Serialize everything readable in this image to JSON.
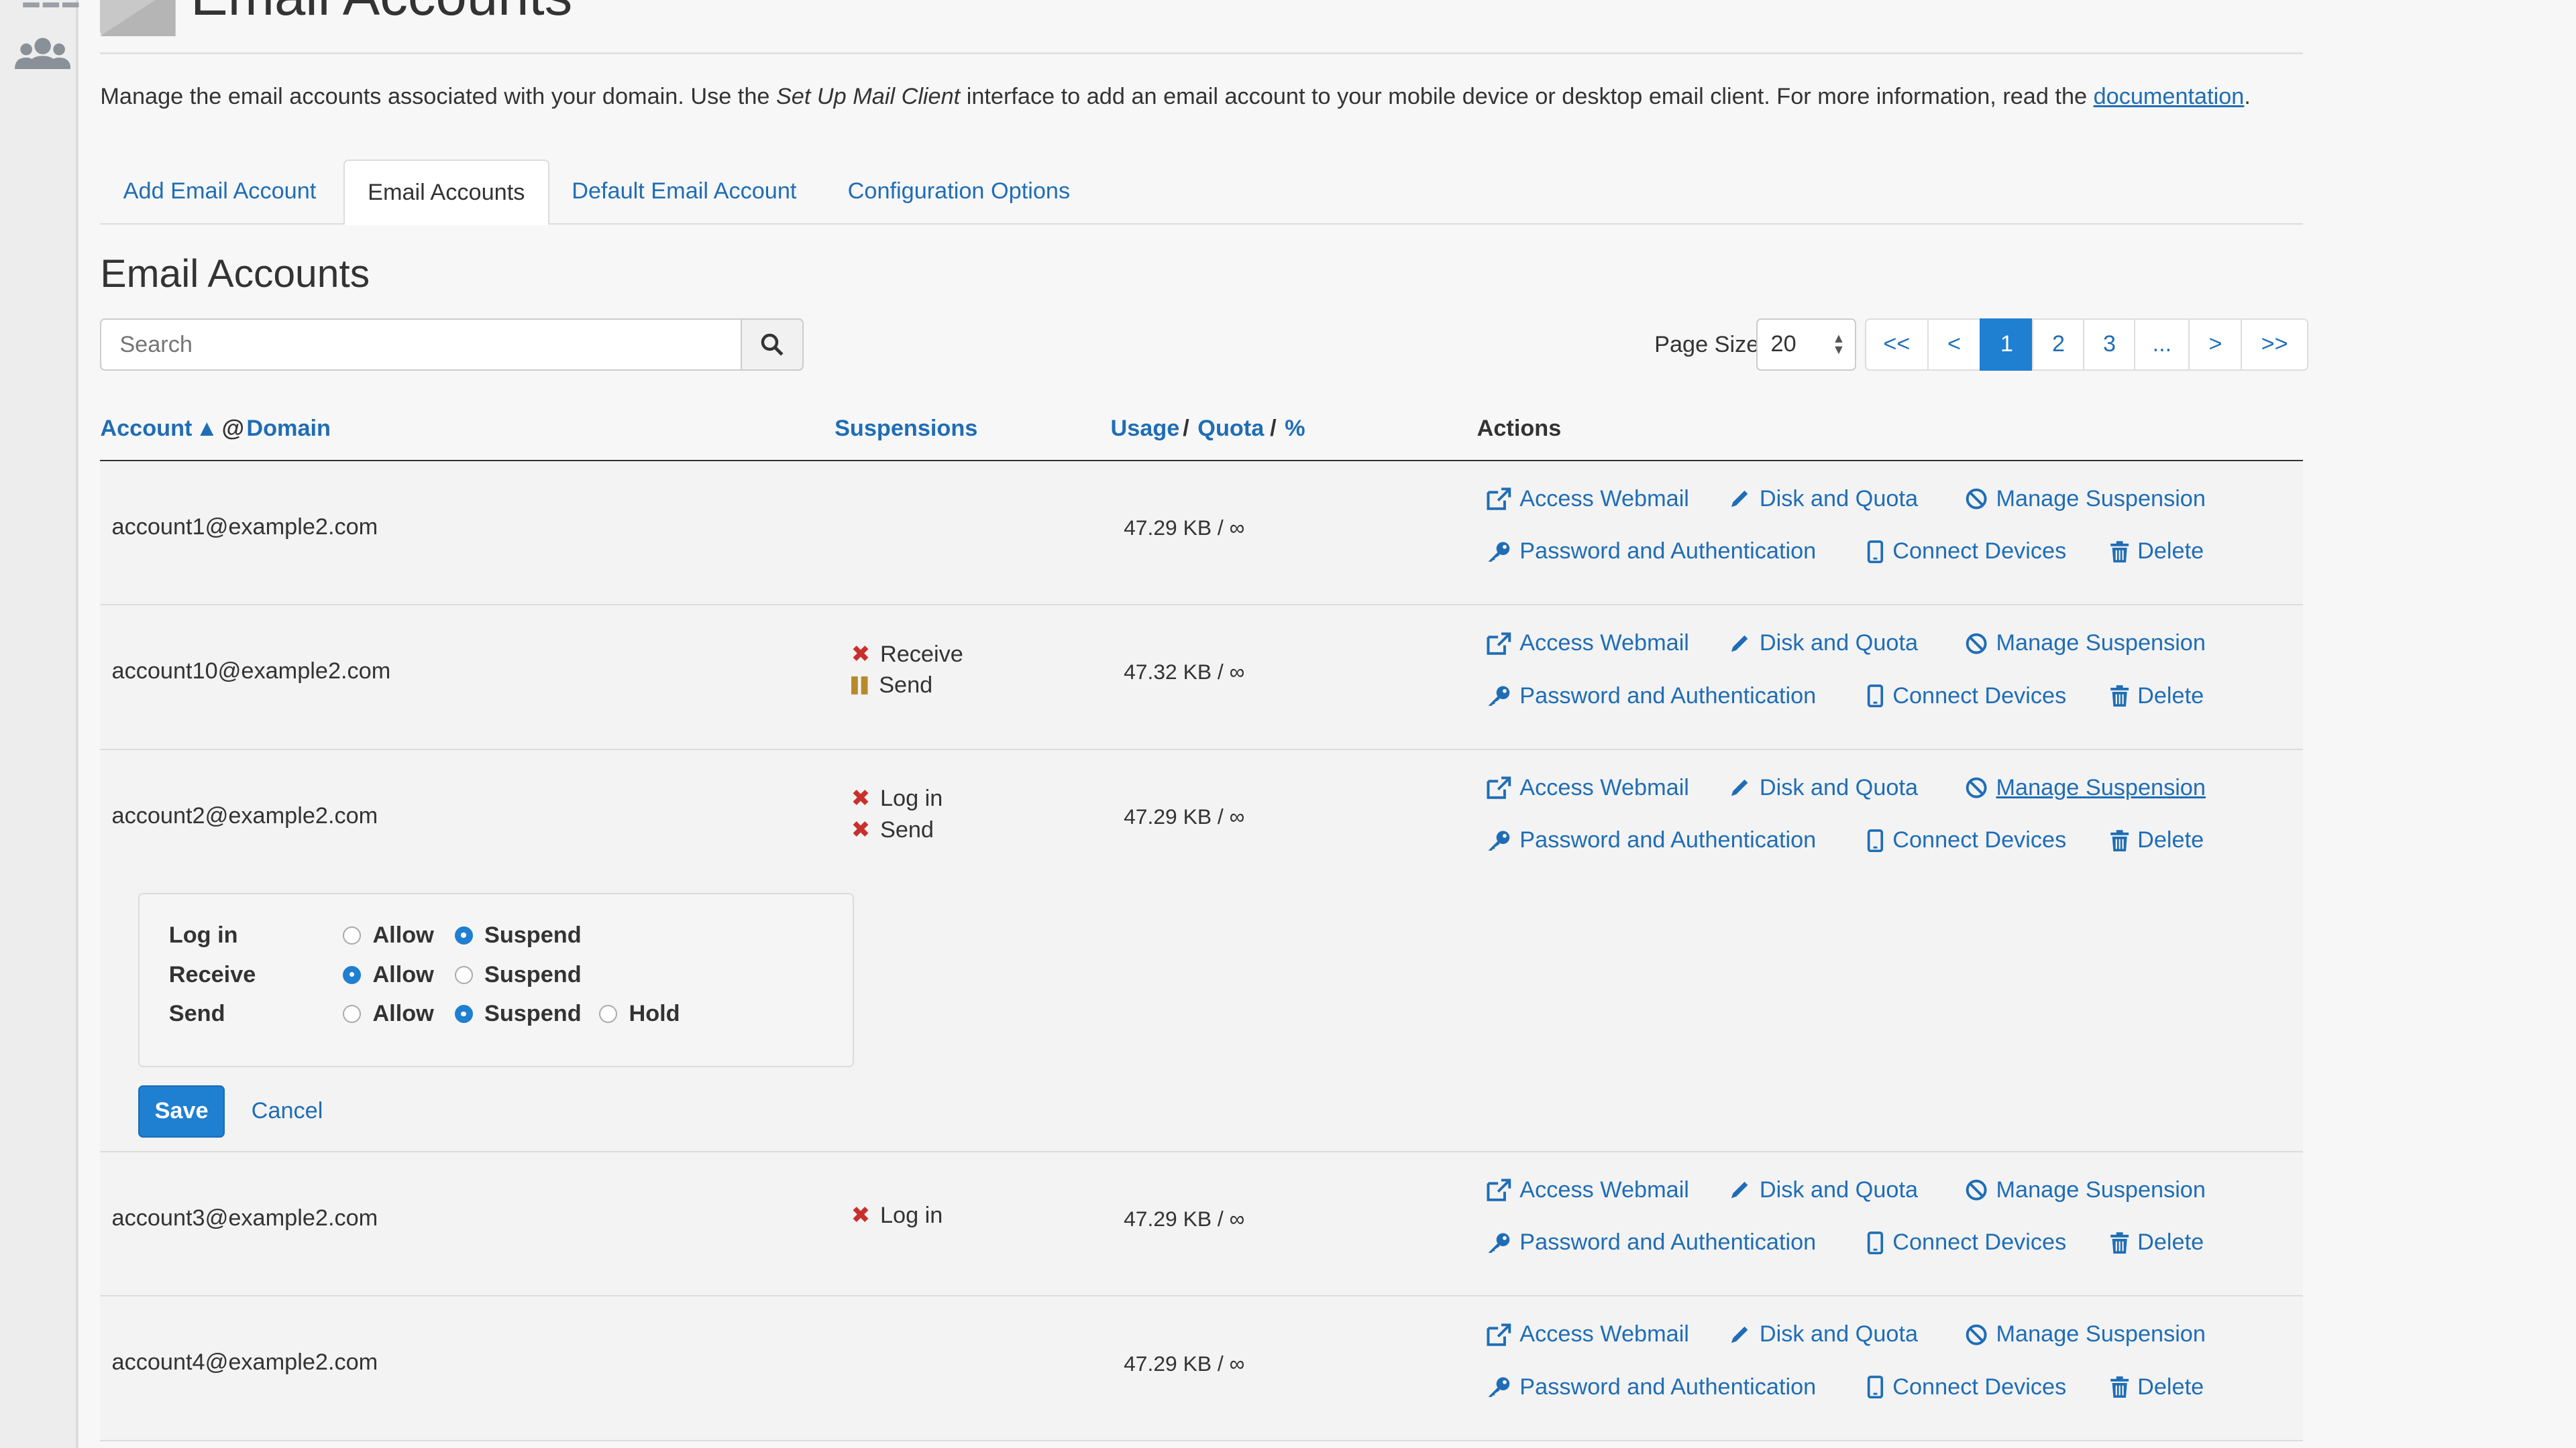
{
  "header": {
    "title": "Email Accounts"
  },
  "intro": {
    "before": "Manage the email accounts associated with your domain. Use the ",
    "em": "Set Up Mail Client",
    "middle": " interface to add an email account to your mobile device or desktop email client. For more information, read the ",
    "link": "documentation",
    "after": "."
  },
  "tabs": [
    {
      "label": "Add Email Account"
    },
    {
      "label": "Email Accounts"
    },
    {
      "label": "Default Email Account"
    },
    {
      "label": "Configuration Options"
    }
  ],
  "section_title": "Email Accounts",
  "search": {
    "placeholder": "Search"
  },
  "paging": {
    "page_size_label": "Page Size",
    "page_size": "20",
    "buttons": [
      "<<",
      "<",
      "1",
      "2",
      "3",
      "...",
      ">",
      ">>"
    ]
  },
  "columns": {
    "account": "Account",
    "at": "@",
    "domain": "Domain",
    "suspensions": "Suspensions",
    "usage": "Usage",
    "quota": "Quota",
    "percent": "%",
    "slash": "/",
    "actions": "Actions"
  },
  "actions": {
    "webmail": "Access Webmail",
    "disk": "Disk and Quota",
    "suspension": "Manage Suspension",
    "password": "Password and Authentication",
    "devices": "Connect Devices",
    "delete": "Delete"
  },
  "accounts": [
    {
      "email": "account1@example2.com",
      "usage": "47.29 KB / ∞",
      "suspensions": []
    },
    {
      "email": "account10@example2.com",
      "usage": "47.32 KB / ∞",
      "suspensions": [
        "Receive",
        "Send"
      ]
    },
    {
      "email": "account2@example2.com",
      "usage": "47.29 KB / ∞",
      "suspensions": [
        "Log in",
        "Send"
      ]
    },
    {
      "email": "account3@example2.com",
      "usage": "47.29 KB / ∞",
      "suspensions": [
        "Log in"
      ]
    },
    {
      "email": "account4@example2.com",
      "usage": "47.29 KB / ∞",
      "suspensions": []
    }
  ],
  "editor": {
    "rows": [
      {
        "label": "Log in",
        "options": [
          "Allow",
          "Suspend"
        ],
        "selected": "Suspend"
      },
      {
        "label": "Receive",
        "options": [
          "Allow",
          "Suspend"
        ],
        "selected": "Allow"
      },
      {
        "label": "Send",
        "options": [
          "Allow",
          "Suspend",
          "Hold"
        ],
        "selected": "Suspend"
      }
    ],
    "save": "Save",
    "cancel": "Cancel"
  },
  "colors": {
    "link": "#1f6db5",
    "primary": "#1f7fd1",
    "danger": "#c9302c",
    "hold": "#b88a2b"
  }
}
